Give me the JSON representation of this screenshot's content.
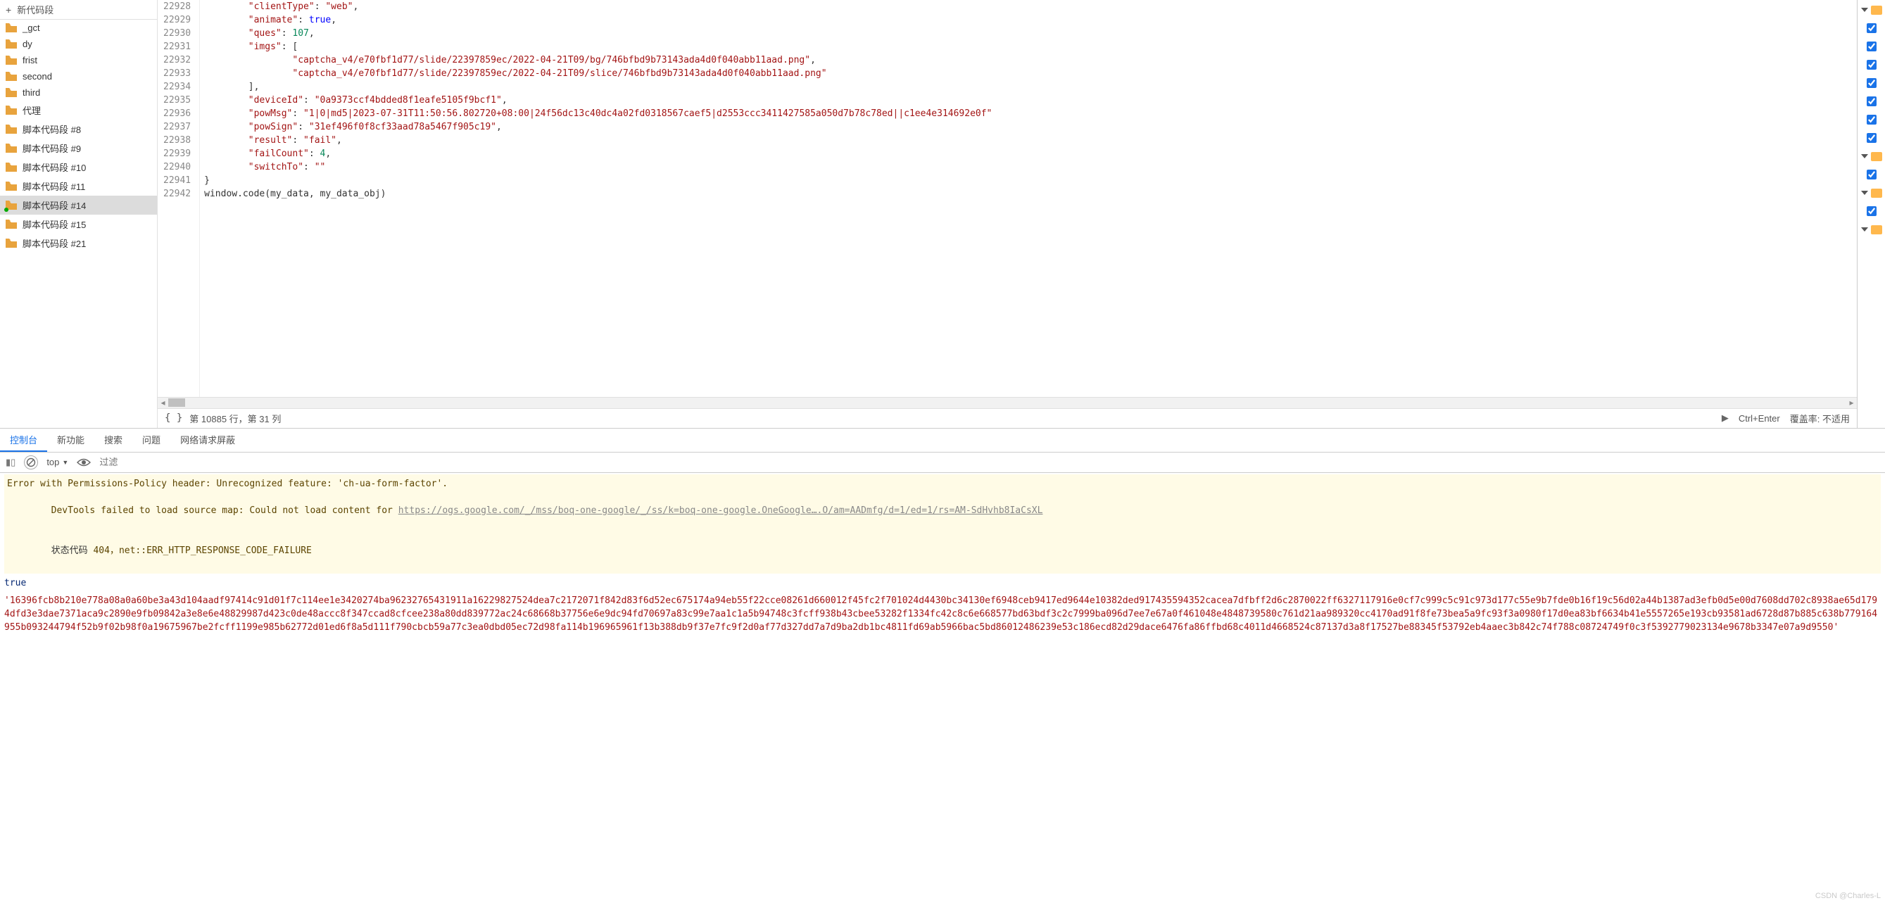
{
  "sidebar": {
    "new_label": "新代码段",
    "items": [
      {
        "label": "_gct"
      },
      {
        "label": "dy"
      },
      {
        "label": "frist"
      },
      {
        "label": "second"
      },
      {
        "label": "third"
      },
      {
        "label": "代理"
      },
      {
        "label": "脚本代码段 #8"
      },
      {
        "label": "脚本代码段 #9"
      },
      {
        "label": "脚本代码段 #10"
      },
      {
        "label": "脚本代码段 #11"
      },
      {
        "label": "脚本代码段 #14"
      },
      {
        "label": "脚本代码段 #15"
      },
      {
        "label": "脚本代码段 #21"
      }
    ],
    "selected_index": 10
  },
  "editor": {
    "lines": [
      {
        "n": "22928",
        "indent": 2,
        "key": "\"clientType\"",
        "val_str": "\"web\"",
        "trail": ","
      },
      {
        "n": "22929",
        "indent": 2,
        "key": "\"animate\"",
        "val_kw": "true",
        "trail": ","
      },
      {
        "n": "22930",
        "indent": 2,
        "key": "\"ques\"",
        "val_num": "107",
        "trail": ","
      },
      {
        "n": "22931",
        "indent": 2,
        "key": "\"imgs\"",
        "raw_after": ": ["
      },
      {
        "n": "22932",
        "indent": 4,
        "val_str_only": "\"captcha_v4/e70fbf1d77/slide/22397859ec/2022-04-21T09/bg/746bfbd9b73143ada4d0f040abb11aad.png\"",
        "trail": ","
      },
      {
        "n": "22933",
        "indent": 4,
        "val_str_only": "\"captcha_v4/e70fbf1d77/slide/22397859ec/2022-04-21T09/slice/746bfbd9b73143ada4d0f040abb11aad.png\""
      },
      {
        "n": "22934",
        "indent": 2,
        "raw": "],"
      },
      {
        "n": "22935",
        "indent": 2,
        "key": "\"deviceId\"",
        "val_str": "\"0a9373ccf4bdded8f1eafe5105f9bcf1\"",
        "trail": ","
      },
      {
        "n": "22936",
        "indent": 2,
        "key": "\"powMsg\"",
        "val_str": "\"1|0|md5|2023-07-31T11:50:56.802720+08:00|24f56dc13c40dc4a02fd0318567caef5|d2553ccc3411427585a050d7b78c78ed||c1ee4e314692e0f\"",
        "trail": ""
      },
      {
        "n": "22937",
        "indent": 2,
        "key": "\"powSign\"",
        "val_str": "\"31ef496f0f8cf33aad78a5467f905c19\"",
        "trail": ","
      },
      {
        "n": "22938",
        "indent": 2,
        "key": "\"result\"",
        "val_str": "\"fail\"",
        "trail": ","
      },
      {
        "n": "22939",
        "indent": 2,
        "key": "\"failCount\"",
        "val_num": "4",
        "trail": ","
      },
      {
        "n": "22940",
        "indent": 2,
        "key": "\"switchTo\"",
        "val_str": "\"\"",
        "trail": ""
      },
      {
        "n": "22941",
        "indent": 0,
        "raw": "}"
      },
      {
        "n": "22942",
        "indent": 0,
        "code_call": "window.code(my_data, my_data_obj)"
      }
    ]
  },
  "status": {
    "cursor": "第 10885 行，第 31 列",
    "run_hint": "Ctrl+Enter",
    "coverage_label": "覆盖率:",
    "coverage_value": "不适用"
  },
  "tabs": {
    "items": [
      "控制台",
      "新功能",
      "搜索",
      "问题",
      "网络请求屏蔽"
    ],
    "active_index": 0
  },
  "toolbar": {
    "context": "top",
    "filter_placeholder": "过滤"
  },
  "console": {
    "warn1": "Error with Permissions-Policy header: Unrecognized feature: 'ch-ua-form-factor'.",
    "warn2_prefix": "DevTools failed to load source map: Could not load content for ",
    "warn2_link": "https://ogs.google.com/_/mss/boq-one-google/_/ss/k=boq-one-google.OneGoogle….O/am=AADmfg/d=1/ed=1/rs=AM-SdHvhb8IaCsXL",
    "warn2_line2_label": "状态代码",
    "warn2_line2_rest": " 404，net::ERR_HTTP_RESPONSE_CODE_FAILURE",
    "true_val": "true",
    "red_hash": "'16396fcb8b210e778a08a0a60be3a43d104aadf97414c91d01f7c114ee1e3420274ba96232765431911a16229827524dea7c2172071f842d83f6d52ec675174a94eb55f22cce08261d660012f45fc2f701024d4430bc34130ef6948ceb9417ed9644e10382ded917435594352cacea7dfbff2d6c2870022ff6327117916e0cf7c999c5c91c973d177c55e9b7fde0b16f19c56d02a44b1387ad3efb0d5e00d7608dd702c8938ae65d1794dfd3e3dae7371aca9c2890e9fb09842a3e8e6e48829987d423c0de48accc8f347ccad8cfcee238a80dd839772ac24c68668b37756e6e9dc94fd70697a83c99e7aa1c1a5b94748c3fcff938b43cbee53282f1334fc42c8c6e668577bd63bdf3c2c7999ba096d7ee7e67a0f461048e4848739580c761d21aa989320cc4170ad91f8fe73bea5a9fc93f3a0980f17d0ea83bf6634b41e5557265e193cb93581ad6728d87b885c638b779164955b093244794f52b9f02b98f0a19675967be2fcff1199e985b62772d01ed6f8a5d111f790cbcb59a77c3ea0dbd05ec72d98fa114b196965961f13b388db9f37e7fc9f2d0af77d327dd7a7d9ba2db1bc4811fd69ab5966bac5bd86012486239e53c186ecd82d29dace6476fa86ffbd68c4011d4668524c87137d3a8f17527be88345f53792eb4aaec3b842c74f788c08724749f0c3f5392779023134e9678b3347e07a9d9550'"
  },
  "watermark": "CSDN @Charles-L"
}
